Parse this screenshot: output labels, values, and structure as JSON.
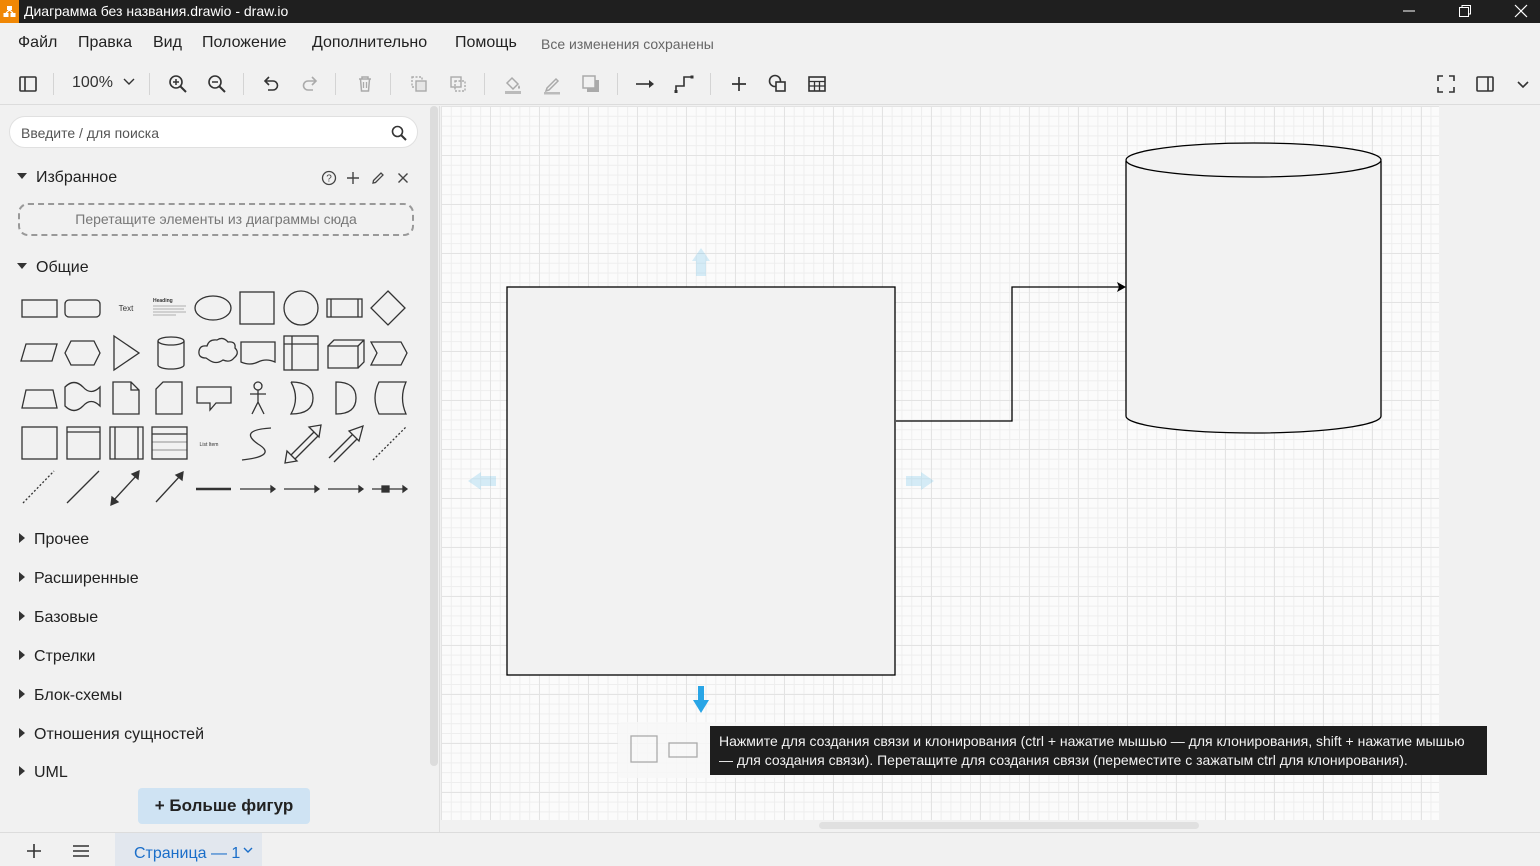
{
  "window": {
    "title": "Диаграмма без названия.drawio - draw.io",
    "controls": [
      "minimize-icon",
      "restore-icon",
      "close-icon"
    ]
  },
  "menu": {
    "items": [
      "Файл",
      "Правка",
      "Вид",
      "Положение",
      "Дополнительно",
      "Помощь"
    ],
    "status": "Все изменения сохранены"
  },
  "toolbar": {
    "zoom": "100%",
    "icons": [
      "sidebar-toggle-icon",
      "zoom-in-icon",
      "zoom-out-icon",
      "undo-icon",
      "redo-icon",
      "delete-icon",
      "to-front-icon",
      "to-back-icon",
      "fill-color-icon",
      "line-color-icon",
      "shadow-icon",
      "connection-icon",
      "waypoints-icon",
      "insert-icon",
      "shapes-icon",
      "table-icon",
      "fullscreen-icon",
      "format-panel-icon",
      "chevron-down-icon"
    ]
  },
  "sidebar": {
    "search_placeholder": "Введите / для поиска",
    "favorites_title": "Избранное",
    "favorites_dropzone": "Перетащите элементы из диаграммы сюда",
    "general_title": "Общие",
    "shape_text_label": "Text",
    "shape_heading_label": "Heading",
    "shape_list_label": "List Item",
    "categories": [
      "Прочее",
      "Расширенные",
      "Базовые",
      "Стрелки",
      "Блок-схемы",
      "Отношения сущностей",
      "UML"
    ],
    "more_shapes": "+ Больше фигур"
  },
  "canvas": {
    "tooltip": "Нажмите для создания связи и клонирования (ctrl + нажатие мышью — для клонирования, shift + нажатие мышью — для создания связи). Перетащите для создания связи (переместите с зажатым ctrl для клонирования).",
    "accent_color": "#29a5e6"
  },
  "bottom": {
    "page_tab": "Страница — 1"
  }
}
